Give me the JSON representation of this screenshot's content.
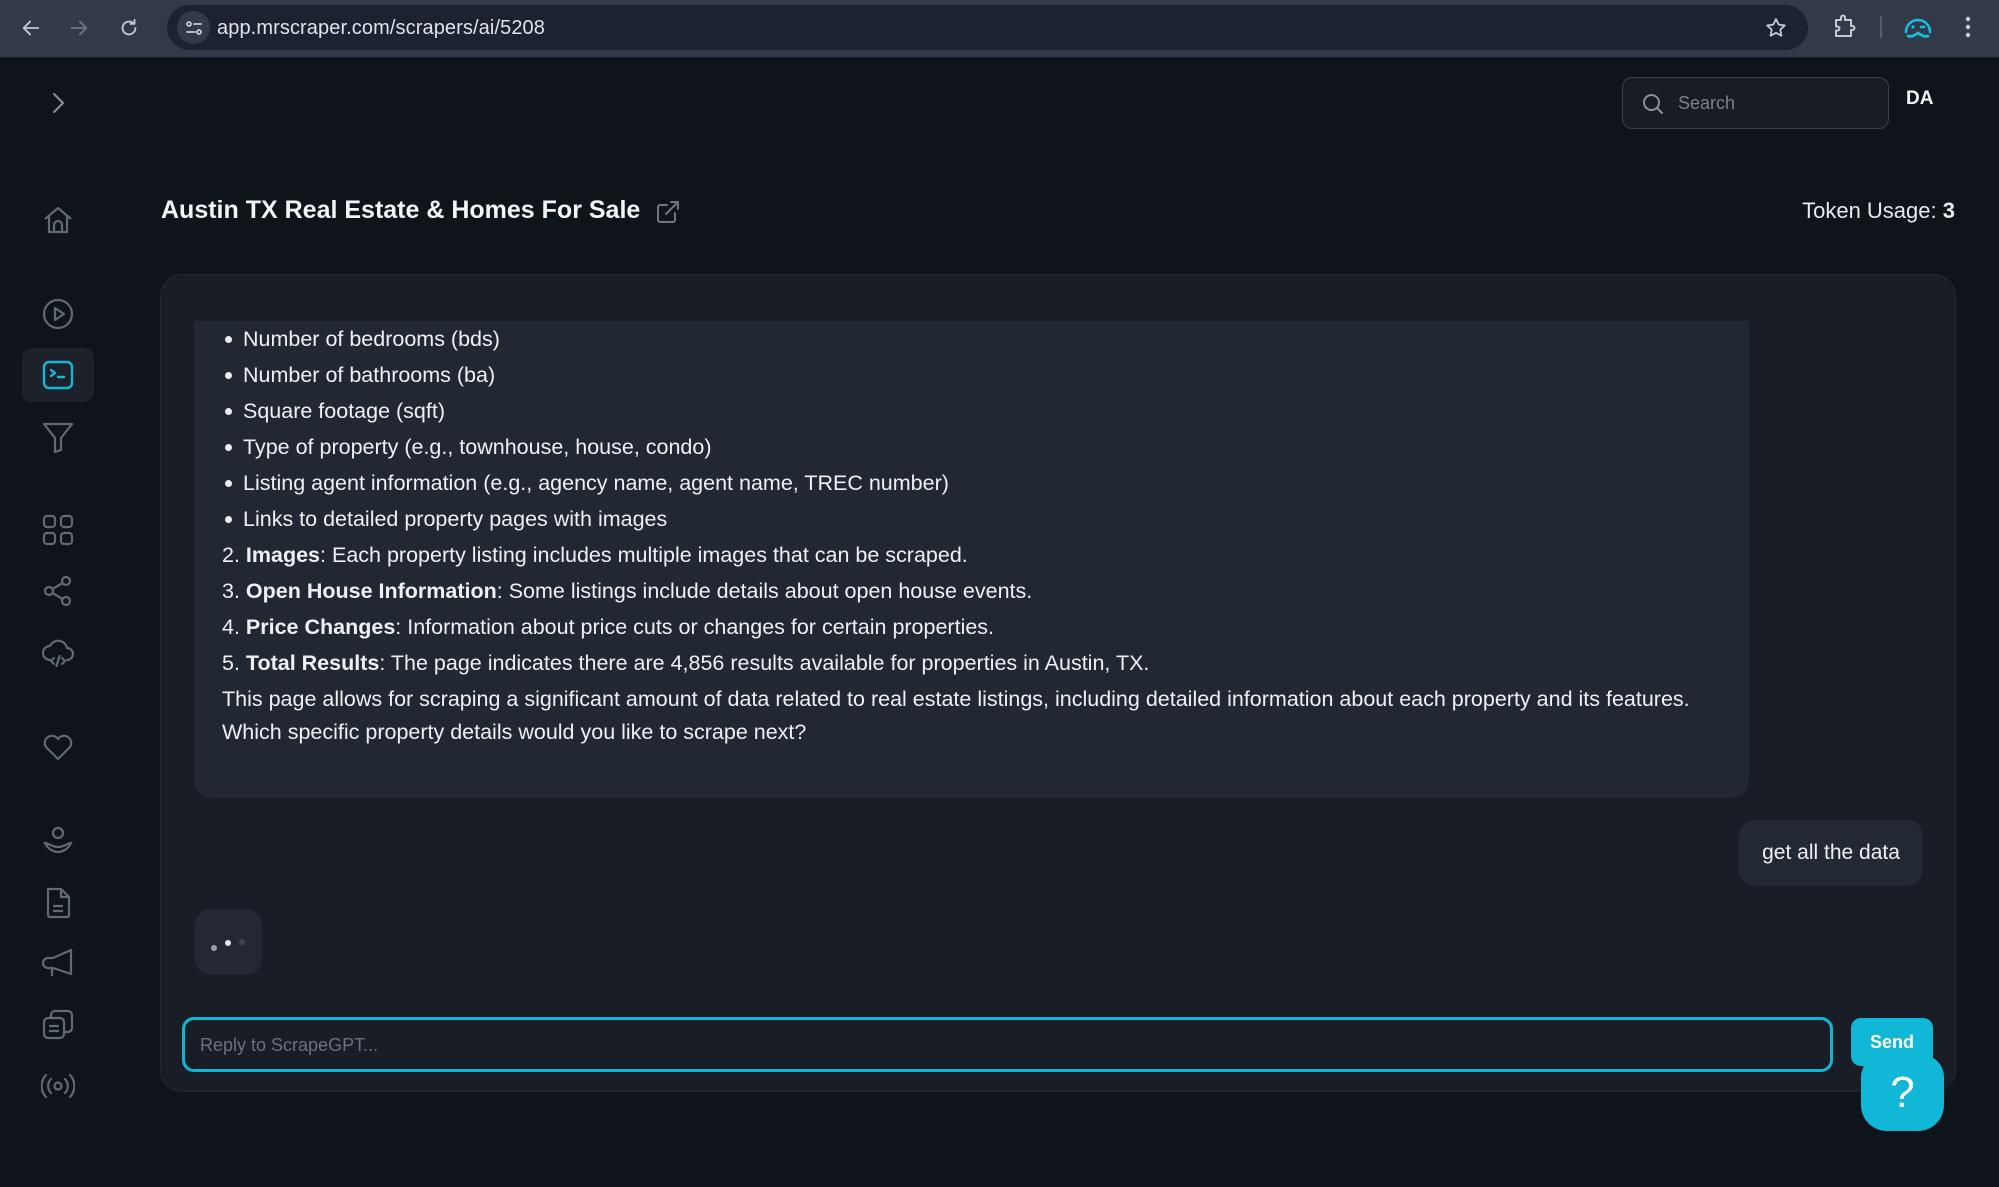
{
  "browser": {
    "url": "app.mrscraper.com/scrapers/ai/5208",
    "icons": [
      "back-arrow-icon",
      "forward-arrow-icon",
      "reload-icon",
      "site-info-icon",
      "bookmark-star-icon",
      "extensions-puzzle-icon",
      "profile-mustache-icon",
      "kebab-menu-icon"
    ]
  },
  "sidebar": {
    "toggle_icon": "chevron-right-icon",
    "items": [
      {
        "name": "home",
        "icon": "home-icon",
        "active": false
      },
      {
        "name": "play",
        "icon": "play-circle-icon",
        "active": false
      },
      {
        "name": "ai-scraper",
        "icon": "terminal-icon",
        "active": true
      },
      {
        "name": "filter",
        "icon": "filter-funnel-icon",
        "active": false
      },
      {
        "name": "dashboard",
        "icon": "grid-icon",
        "active": false
      },
      {
        "name": "integrations",
        "icon": "share-nodes-icon",
        "active": false
      },
      {
        "name": "api",
        "icon": "cloud-code-icon",
        "active": false
      },
      {
        "name": "favorites",
        "icon": "heart-icon",
        "active": false
      },
      {
        "name": "account",
        "icon": "user-icon",
        "active": false
      },
      {
        "name": "docs",
        "icon": "document-icon",
        "active": false
      },
      {
        "name": "announcements",
        "icon": "megaphone-icon",
        "active": false
      },
      {
        "name": "templates",
        "icon": "copy-stack-icon",
        "active": false
      },
      {
        "name": "broadcast",
        "icon": "radio-waves-icon",
        "active": false
      }
    ]
  },
  "header": {
    "search_placeholder": "Search",
    "avatar_initials": "DA"
  },
  "page": {
    "title": "Austin TX Real Estate & Homes For Sale",
    "token_usage_label": "Token Usage:",
    "token_usage_value": "3"
  },
  "chat": {
    "assistant_message": {
      "bullets": [
        "Number of bedrooms (bds)",
        "Number of bathrooms (ba)",
        "Square footage (sqft)",
        "Type of property (e.g., townhouse, house, condo)",
        "Listing agent information (e.g., agency name, agent name, TREC number)",
        "Links to detailed property pages with images"
      ],
      "numbered": [
        {
          "num": "2.",
          "title": "Images",
          "text": ": Each property listing includes multiple images that can be scraped."
        },
        {
          "num": "3.",
          "title": "Open House Information",
          "text": ": Some listings include details about open house events."
        },
        {
          "num": "4.",
          "title": "Price Changes",
          "text": ": Information about price cuts or changes for certain properties."
        },
        {
          "num": "5.",
          "title": "Total Results",
          "text": ": The page indicates there are 4,856 results available for properties in Austin, TX."
        }
      ],
      "summary": "This page allows for scraping a significant amount of data related to real estate listings, including detailed information about each property and its features.",
      "question": "Which specific property details would you like to scrape next?"
    },
    "user_message": "get all the data",
    "loading": true,
    "input_placeholder": "Reply to ScrapeGPT...",
    "input_value": "",
    "send_label": "Send",
    "help_label": "?"
  },
  "colors": {
    "accent": "#10b7d6",
    "background": "#0f131a",
    "panel": "#181d26",
    "bubble": "#222832"
  }
}
